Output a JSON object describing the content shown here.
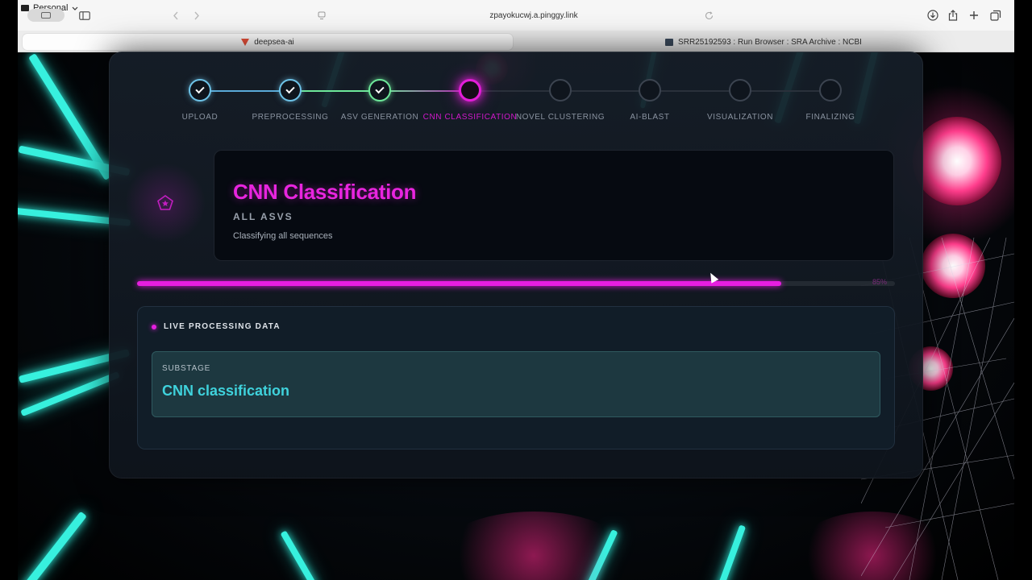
{
  "browser": {
    "profile_label": "Personal",
    "address": "zpayokucwj.a.pinggy.link",
    "tabs": [
      {
        "label": "deepsea-ai",
        "active": true
      },
      {
        "label": "SRR25192593 : Run Browser : SRA Archive : NCBI",
        "active": false
      }
    ]
  },
  "colors": {
    "accent_magenta": "#e61ee0",
    "done_blue": "#6ec3e8",
    "done_green": "#6ee89a",
    "substage_cyan": "#3fd2dc"
  },
  "stepper": {
    "steps": [
      {
        "label": "UPLOAD",
        "status": "done"
      },
      {
        "label": "PREPROCESSING",
        "status": "done"
      },
      {
        "label": "ASV GENERATION",
        "status": "done"
      },
      {
        "label": "CNN CLASSIFICATION",
        "status": "active"
      },
      {
        "label": "NOVEL CLUSTERING",
        "status": "pending"
      },
      {
        "label": "AI-BLAST",
        "status": "pending"
      },
      {
        "label": "VISUALIZATION",
        "status": "pending"
      },
      {
        "label": "FINALIZING",
        "status": "pending"
      }
    ]
  },
  "stage": {
    "icon": "pentagon-star-icon",
    "title": "CNN Classification",
    "subtitle": "ALL ASVS",
    "description": "Classifying all sequences"
  },
  "progress": {
    "value": 85,
    "label": "85%"
  },
  "live": {
    "heading": "LIVE PROCESSING DATA",
    "substage_label": "SUBSTAGE",
    "substage_value": "CNN classification"
  }
}
